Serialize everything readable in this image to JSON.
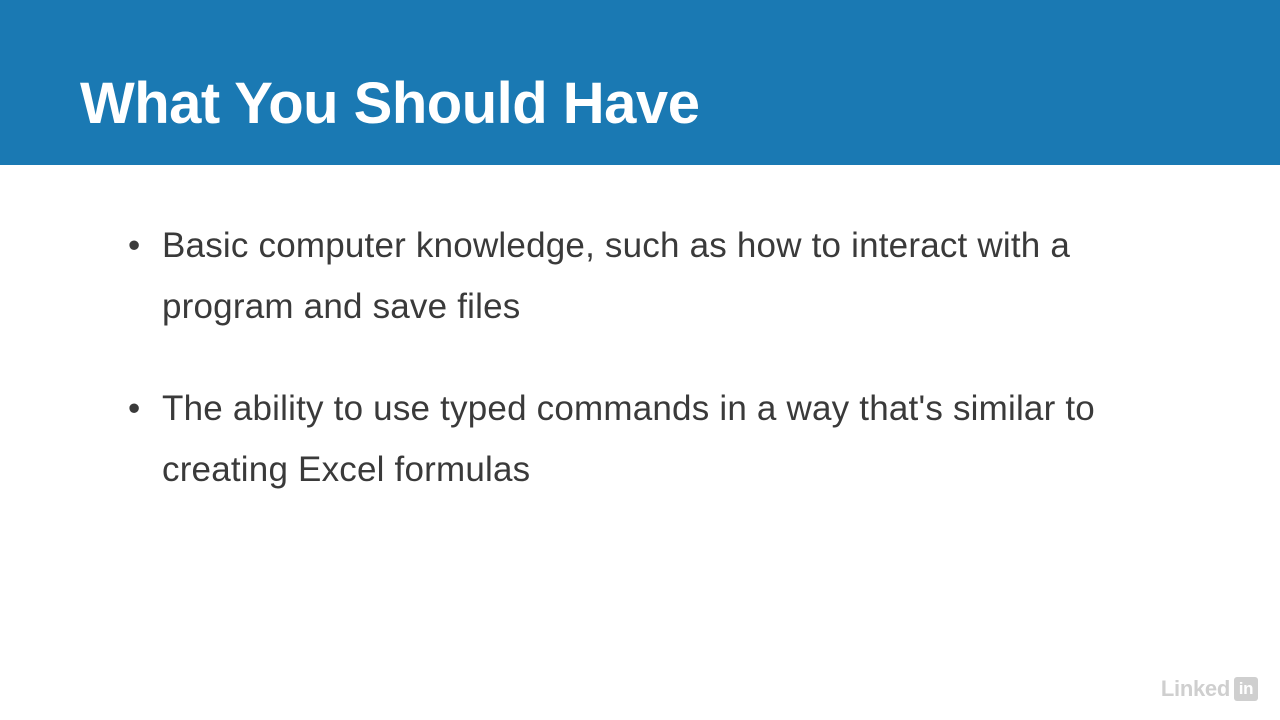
{
  "header": {
    "title": "What You Should Have"
  },
  "content": {
    "bullets": [
      "Basic computer knowledge, such as how to interact with a program and save files",
      "The ability to use typed commands in a way that's similar to creating Excel formulas"
    ]
  },
  "watermark": {
    "text_linked": "Linked",
    "text_in": "in"
  }
}
